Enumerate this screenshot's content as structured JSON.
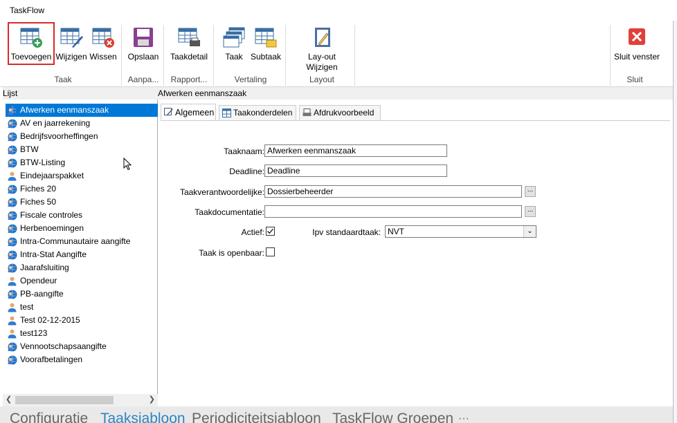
{
  "window": {
    "title": "TaskFlow"
  },
  "ribbon": {
    "buttons": {
      "toevoegen": "Toevoegen",
      "wijzigen": "Wijzigen",
      "wissen": "Wissen",
      "opslaan": "Opslaan",
      "taakdetail": "Taakdetail",
      "taak": "Taak",
      "subtaak": "Subtaak",
      "layout_line1": "Lay-out",
      "layout_line2": "Wijzigen",
      "sluit": "Sluit venster"
    },
    "groups": {
      "taak": "Taak",
      "aanpassen": "Aanpa...",
      "rapport": "Rapport...",
      "vertaling": "Vertaling",
      "layout": "Layout",
      "sluit": "Sluit"
    }
  },
  "left_panel": {
    "header": "Lijst",
    "items": [
      {
        "label": "Afwerken eenmanszaak",
        "icon": "globe-user-icon",
        "selected": true
      },
      {
        "label": "AV en jaarrekening",
        "icon": "globe-user-icon"
      },
      {
        "label": "Bedrijfsvoorheffingen",
        "icon": "globe-user-icon"
      },
      {
        "label": "BTW",
        "icon": "globe-user-icon"
      },
      {
        "label": "BTW-Listing",
        "icon": "globe-user-icon"
      },
      {
        "label": "Eindejaarspakket",
        "icon": "user-icon"
      },
      {
        "label": "Fiches 20",
        "icon": "globe-user-icon"
      },
      {
        "label": "Fiches 50",
        "icon": "globe-user-icon"
      },
      {
        "label": "Fiscale controles",
        "icon": "globe-user-icon"
      },
      {
        "label": "Herbenoemingen",
        "icon": "globe-user-icon"
      },
      {
        "label": "Intra-Communautaire aangifte",
        "icon": "globe-user-icon"
      },
      {
        "label": "Intra-Stat Aangifte",
        "icon": "globe-user-icon"
      },
      {
        "label": "Jaarafsluiting",
        "icon": "globe-user-icon"
      },
      {
        "label": "Opendeur",
        "icon": "user-icon"
      },
      {
        "label": "PB-aangifte",
        "icon": "globe-user-icon"
      },
      {
        "label": "test",
        "icon": "user-icon"
      },
      {
        "label": "Test 02-12-2015",
        "icon": "user-icon"
      },
      {
        "label": "test123",
        "icon": "user-icon"
      },
      {
        "label": "Vennootschapsaangifte",
        "icon": "globe-user-icon"
      },
      {
        "label": "Voorafbetalingen",
        "icon": "globe-user-icon"
      }
    ]
  },
  "right_panel": {
    "header": "Afwerken eenmanszaak",
    "tabs": [
      "Algemeen",
      "Taakonderdelen",
      "Afdrukvoorbeeld"
    ],
    "form": {
      "taaknaam_label": "Taaknaam:",
      "taaknaam_value": "Afwerken eenmanszaak",
      "deadline_label": "Deadline:",
      "deadline_value": "Deadline",
      "verantw_label": "Taakverantwoordelijke:",
      "verantw_value": "Dossierbeheerder",
      "doc_label": "Taakdocumentatie:",
      "doc_value": "",
      "actief_label": "Actief:",
      "actief_checked": true,
      "ipv_label": "Ipv standaardtaak:",
      "ipv_value": "NVT",
      "openbaar_label": "Taak is openbaar:",
      "openbaar_checked": false,
      "ellipsis": "..."
    }
  },
  "bottom_tabs": [
    "Configuratie",
    "Taaksjabloon",
    "Periodiciteitsjabloon",
    "TaskFlow Groepen",
    "···"
  ],
  "bottom_active": "Taaksjabloon",
  "colors": {
    "accent": "#0078d7",
    "selected_border": "#d62b2b",
    "close_red": "#e0403a"
  }
}
